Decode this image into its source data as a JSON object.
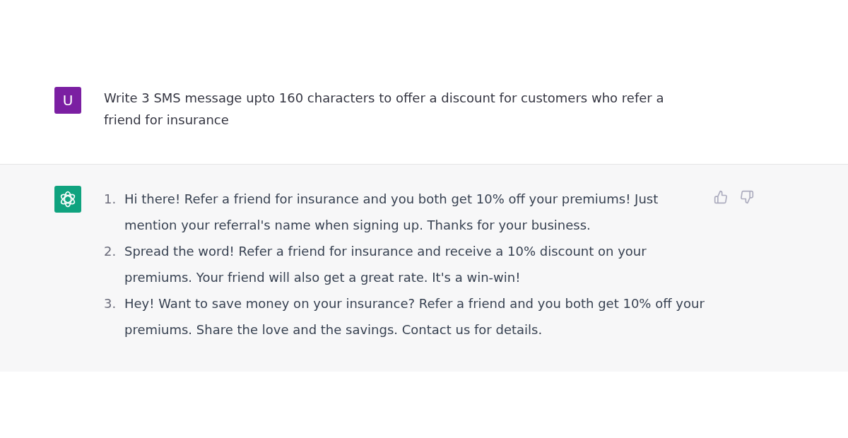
{
  "conversation": [
    {
      "kind": "user",
      "avatar": "U",
      "text": "Write 3 SMS message upto 160 characters to offer a discount for customers who refer a friend for insurance"
    },
    {
      "kind": "assistant",
      "items": [
        {
          "number": "1.",
          "text": "Hi there! Refer a friend for insurance and you both get 10% off your premiums! Just mention your referral's name when signing up. Thanks for your business."
        },
        {
          "number": "2.",
          "text": "Spread the word! Refer a friend for insurance and receive a 10% discount on your premiums. Your friend will also get a great rate. It's a win-win!"
        },
        {
          "number": "3.",
          "text": "Hey! Want to save money on your insurance? Refer a friend and you both get 10% off your premiums. Share the love and the savings. Contact us for details."
        }
      ]
    }
  ]
}
